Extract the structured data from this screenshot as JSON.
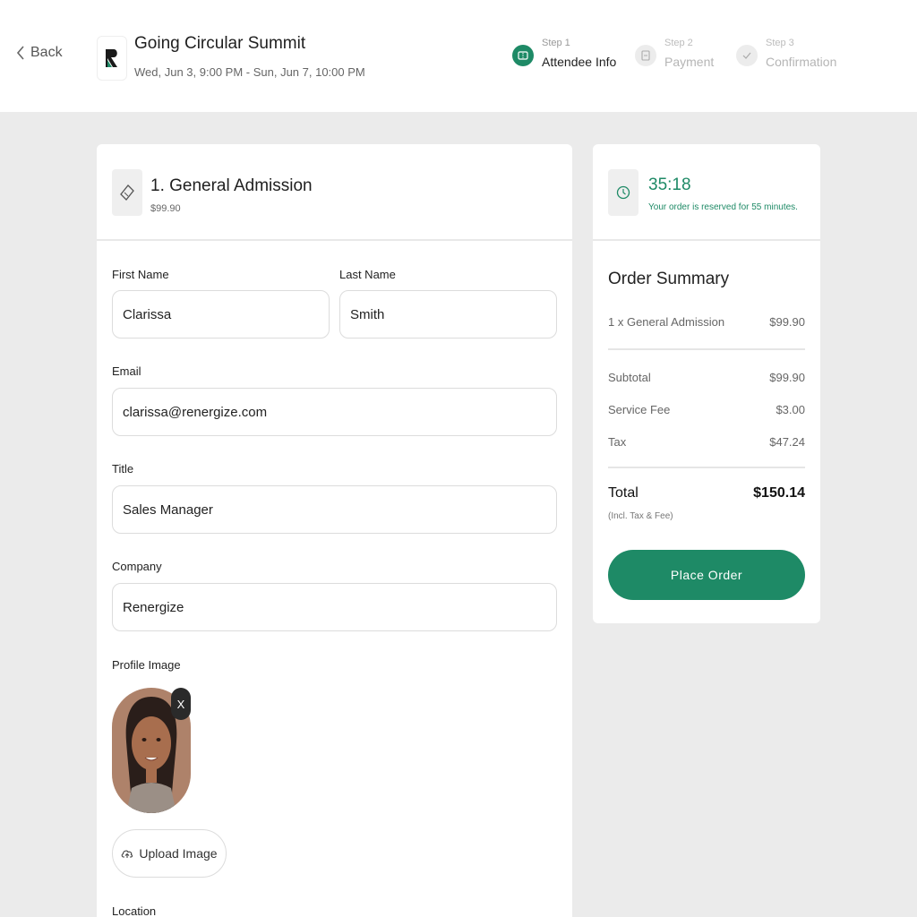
{
  "header": {
    "back_label": "Back",
    "event_title": "Going Circular Summit",
    "event_dates": "Wed, Jun 3, 9:00 PM - Sun, Jun 7, 10:00 PM",
    "steps": [
      {
        "small": "Step 1",
        "label": "Attendee Info",
        "state": "active"
      },
      {
        "small": "Step 2",
        "label": "Payment",
        "state": "inactive"
      },
      {
        "small": "Step 3",
        "label": "Confirmation",
        "state": "inactive"
      }
    ]
  },
  "ticket": {
    "name": "1. General Admission",
    "price": "$99.90"
  },
  "form": {
    "first_name_label": "First Name",
    "first_name_value": "Clarissa",
    "last_name_label": "Last Name",
    "last_name_value": "Smith",
    "email_label": "Email",
    "email_value": "clarissa@renergize.com",
    "title_label": "Title",
    "title_value": "Sales Manager",
    "company_label": "Company",
    "company_value": "Renergize",
    "profile_image_label": "Profile Image",
    "remove_glyph": "X",
    "upload_label": "Upload Image",
    "location_label": "Location"
  },
  "timer": {
    "value": "35:18",
    "note": "Your order is reserved for 55 minutes."
  },
  "summary": {
    "title": "Order Summary",
    "item_label": "1 x General Admission",
    "item_value": "$99.90",
    "subtotal_label": "Subtotal",
    "subtotal_value": "$99.90",
    "fee_label": "Service Fee",
    "fee_value": "$3.00",
    "tax_label": "Tax",
    "tax_value": "$47.24",
    "total_label": "Total",
    "total_value": "$150.14",
    "total_note": "(Incl. Tax & Fee)",
    "place_order_label": "Place Order"
  },
  "colors": {
    "accent": "#1e8a66",
    "background": "#ebebeb",
    "card": "#ffffff"
  },
  "icons": [
    "chevron-left-icon",
    "logo-icon",
    "ticket-step-icon",
    "payment-step-icon",
    "check-step-icon",
    "ticket-icon",
    "clock-icon",
    "close-icon",
    "upload-cloud-icon"
  ]
}
